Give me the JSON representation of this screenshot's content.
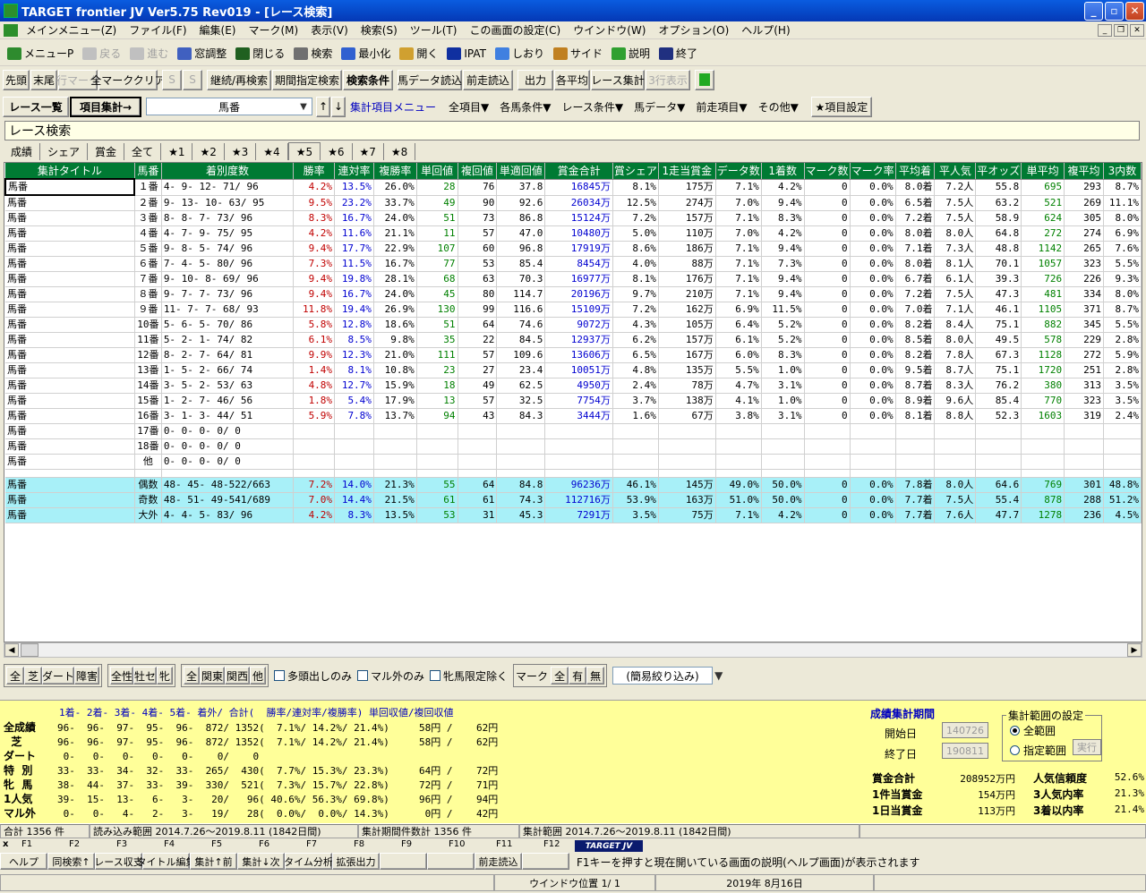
{
  "window": {
    "title": "TARGET frontier JV  Ver5.75  Rev019 - [レース検索]"
  },
  "menu": [
    "メインメニュー(Z)",
    "ファイル(F)",
    "編集(E)",
    "マーク(M)",
    "表示(V)",
    "検索(S)",
    "ツール(T)",
    "この画面の設定(C)",
    "ウインドウ(W)",
    "オプション(O)",
    "ヘルプ(H)"
  ],
  "toolbar1": [
    {
      "label": "メニューP",
      "icon": "menu-p-icon",
      "color": "#2e8b2e",
      "disabled": false
    },
    {
      "label": "戻る",
      "icon": "back-arrow-icon",
      "color": "#c0c0c0",
      "disabled": true
    },
    {
      "label": "進む",
      "icon": "forward-arrow-icon",
      "color": "#c0c0c0",
      "disabled": true
    },
    {
      "label": "窓調整",
      "icon": "window-adjust-icon",
      "color": "#4060c0",
      "disabled": false
    },
    {
      "label": "閉じる",
      "icon": "close-window-icon",
      "color": "#206020",
      "disabled": false
    },
    {
      "label": "検索",
      "icon": "search-icon",
      "color": "#707070",
      "disabled": false
    },
    {
      "label": "最小化",
      "icon": "minimize-icon",
      "color": "#3060d0",
      "disabled": false
    },
    {
      "label": "開く",
      "icon": "open-icon",
      "color": "#d0a030",
      "disabled": false
    },
    {
      "label": "IPAT",
      "icon": "pat-icon",
      "color": "#1030a0",
      "disabled": false
    },
    {
      "label": "しおり",
      "icon": "bookmark-icon",
      "color": "#4080e0",
      "disabled": false
    },
    {
      "label": "サイド",
      "icon": "side-icon",
      "color": "#c08020",
      "disabled": false
    },
    {
      "label": "説明",
      "icon": "help-icon",
      "color": "#30a030",
      "disabled": false
    },
    {
      "label": "終了",
      "icon": "exit-icon",
      "color": "#203080",
      "disabled": false
    }
  ],
  "toolbar2": [
    {
      "label": "先頭",
      "w": 30,
      "dis": false,
      "bold": false
    },
    {
      "label": "末尾",
      "w": 30,
      "dis": false,
      "bold": false
    },
    {
      "label": "行マーク",
      "w": 44,
      "dis": true,
      "bold": false
    },
    {
      "label": "全マーククリア",
      "w": 66,
      "dis": false,
      "bold": false
    },
    {
      "label": "S",
      "w": 22,
      "dis": true,
      "bold": false
    },
    {
      "label": "S",
      "w": 22,
      "dis": true,
      "bold": false
    },
    {
      "label": "継続/再検索",
      "w": 72,
      "dis": false,
      "bold": false
    },
    {
      "label": "期間指定検索",
      "w": 78,
      "dis": false,
      "bold": false
    },
    {
      "label": "検索条件",
      "w": 56,
      "dis": false,
      "bold": true
    },
    {
      "label": "馬データ読込",
      "w": 72,
      "dis": false,
      "bold": false
    },
    {
      "label": "前走読込",
      "w": 56,
      "dis": false,
      "bold": false
    },
    {
      "label": "出力",
      "w": 40,
      "dis": false,
      "bold": false
    },
    {
      "label": "各平均",
      "w": 40,
      "dis": false,
      "bold": false
    },
    {
      "label": "レース集計",
      "w": 60,
      "dis": false,
      "bold": false
    },
    {
      "label": "3行表示",
      "w": 50,
      "dis": true,
      "bold": false
    }
  ],
  "toolbar3": {
    "race_list": "レース一覧",
    "item_sum": "項目集計→",
    "combo_value": "馬番",
    "item_menu": "集計項目メニュー",
    "dropdowns": [
      "全項目▼",
      "各馬条件▼",
      "レース条件▼",
      "馬データ▼",
      "前走項目▼",
      "その他▼"
    ],
    "item_setting": "★項目設定"
  },
  "race_title": "レース検索",
  "tabs": [
    "成績",
    "シェア",
    "賞金",
    "全て",
    "★1",
    "★2",
    "★3",
    "★4",
    "★5",
    "★6",
    "★7",
    "★8"
  ],
  "active_tab": 8,
  "grid": {
    "headers": [
      "集計タイトル",
      "馬番",
      "着別度数",
      "勝率",
      "連対率",
      "複勝率",
      "単回値",
      "複回値",
      "単適回値",
      "賞金合計",
      "賞シェア",
      "1走当賞金",
      "データ数",
      "1着数",
      "マーク数",
      "マーク率",
      "平均着",
      "平人気",
      "平オッズ",
      "単平均",
      "複平均",
      "3内数"
    ],
    "rows": [
      [
        "馬番",
        "１番",
        "4-  9- 12- 71/ 96",
        "4.2%",
        "13.5%",
        "26.0%",
        "28",
        "76",
        "37.8",
        "16845万",
        "8.1%",
        "175万",
        "7.1%",
        "4.2%",
        "0",
        "0.0%",
        "8.0着",
        "7.2人",
        "55.8",
        "695",
        "293",
        "8.7%"
      ],
      [
        "馬番",
        "２番",
        "9- 13- 10- 63/ 95",
        "9.5%",
        "23.2%",
        "33.7%",
        "49",
        "90",
        "92.6",
        "26034万",
        "12.5%",
        "274万",
        "7.0%",
        "9.4%",
        "0",
        "0.0%",
        "6.5着",
        "7.5人",
        "63.2",
        "521",
        "269",
        "11.1%"
      ],
      [
        "馬番",
        "３番",
        "8-  8-  7- 73/ 96",
        "8.3%",
        "16.7%",
        "24.0%",
        "51",
        "73",
        "86.8",
        "15124万",
        "7.2%",
        "157万",
        "7.1%",
        "8.3%",
        "0",
        "0.0%",
        "7.2着",
        "7.5人",
        "58.9",
        "624",
        "305",
        "8.0%"
      ],
      [
        "馬番",
        "４番",
        "4-  7-  9- 75/ 95",
        "4.2%",
        "11.6%",
        "21.1%",
        "11",
        "57",
        "47.0",
        "10480万",
        "5.0%",
        "110万",
        "7.0%",
        "4.2%",
        "0",
        "0.0%",
        "8.0着",
        "8.0人",
        "64.8",
        "272",
        "274",
        "6.9%"
      ],
      [
        "馬番",
        "５番",
        "9-  8-  5- 74/ 96",
        "9.4%",
        "17.7%",
        "22.9%",
        "107",
        "60",
        "96.8",
        "17919万",
        "8.6%",
        "186万",
        "7.1%",
        "9.4%",
        "0",
        "0.0%",
        "7.1着",
        "7.3人",
        "48.8",
        "1142",
        "265",
        "7.6%"
      ],
      [
        "馬番",
        "６番",
        "7-  4-  5- 80/ 96",
        "7.3%",
        "11.5%",
        "16.7%",
        "77",
        "53",
        "85.4",
        "8454万",
        "4.0%",
        "88万",
        "7.1%",
        "7.3%",
        "0",
        "0.0%",
        "8.0着",
        "8.1人",
        "70.1",
        "1057",
        "323",
        "5.5%"
      ],
      [
        "馬番",
        "７番",
        "9- 10-  8- 69/ 96",
        "9.4%",
        "19.8%",
        "28.1%",
        "68",
        "63",
        "70.3",
        "16977万",
        "8.1%",
        "176万",
        "7.1%",
        "9.4%",
        "0",
        "0.0%",
        "6.7着",
        "6.1人",
        "39.3",
        "726",
        "226",
        "9.3%"
      ],
      [
        "馬番",
        "８番",
        "9-  7-  7- 73/ 96",
        "9.4%",
        "16.7%",
        "24.0%",
        "45",
        "80",
        "114.7",
        "20196万",
        "9.7%",
        "210万",
        "7.1%",
        "9.4%",
        "0",
        "0.0%",
        "7.2着",
        "7.5人",
        "47.3",
        "481",
        "334",
        "8.0%"
      ],
      [
        "馬番",
        "９番",
        "11-  7-  7- 68/ 93",
        "11.8%",
        "19.4%",
        "26.9%",
        "130",
        "99",
        "116.6",
        "15109万",
        "7.2%",
        "162万",
        "6.9%",
        "11.5%",
        "0",
        "0.0%",
        "7.0着",
        "7.1人",
        "46.1",
        "1105",
        "371",
        "8.7%"
      ],
      [
        "馬番",
        "10番",
        "5-  6-  5- 70/ 86",
        "5.8%",
        "12.8%",
        "18.6%",
        "51",
        "64",
        "74.6",
        "9072万",
        "4.3%",
        "105万",
        "6.4%",
        "5.2%",
        "0",
        "0.0%",
        "8.2着",
        "8.4人",
        "75.1",
        "882",
        "345",
        "5.5%"
      ],
      [
        "馬番",
        "11番",
        "5-  2-  1- 74/ 82",
        "6.1%",
        "8.5%",
        "9.8%",
        "35",
        "22",
        "84.5",
        "12937万",
        "6.2%",
        "157万",
        "6.1%",
        "5.2%",
        "0",
        "0.0%",
        "8.5着",
        "8.0人",
        "49.5",
        "578",
        "229",
        "2.8%"
      ],
      [
        "馬番",
        "12番",
        "8-  2-  7- 64/ 81",
        "9.9%",
        "12.3%",
        "21.0%",
        "111",
        "57",
        "109.6",
        "13606万",
        "6.5%",
        "167万",
        "6.0%",
        "8.3%",
        "0",
        "0.0%",
        "8.2着",
        "7.8人",
        "67.3",
        "1128",
        "272",
        "5.9%"
      ],
      [
        "馬番",
        "13番",
        "1-  5-  2- 66/ 74",
        "1.4%",
        "8.1%",
        "10.8%",
        "23",
        "27",
        "23.4",
        "10051万",
        "4.8%",
        "135万",
        "5.5%",
        "1.0%",
        "0",
        "0.0%",
        "9.5着",
        "8.7人",
        "75.1",
        "1720",
        "251",
        "2.8%"
      ],
      [
        "馬番",
        "14番",
        "3-  5-  2- 53/ 63",
        "4.8%",
        "12.7%",
        "15.9%",
        "18",
        "49",
        "62.5",
        "4950万",
        "2.4%",
        "78万",
        "4.7%",
        "3.1%",
        "0",
        "0.0%",
        "8.7着",
        "8.3人",
        "76.2",
        "380",
        "313",
        "3.5%"
      ],
      [
        "馬番",
        "15番",
        "1-  2-  7- 46/ 56",
        "1.8%",
        "5.4%",
        "17.9%",
        "13",
        "57",
        "32.5",
        "7754万",
        "3.7%",
        "138万",
        "4.1%",
        "1.0%",
        "0",
        "0.0%",
        "8.9着",
        "9.6人",
        "85.4",
        "770",
        "323",
        "3.5%"
      ],
      [
        "馬番",
        "16番",
        "3-  1-  3- 44/ 51",
        "5.9%",
        "7.8%",
        "13.7%",
        "94",
        "43",
        "84.3",
        "3444万",
        "1.6%",
        "67万",
        "3.8%",
        "3.1%",
        "0",
        "0.0%",
        "8.1着",
        "8.8人",
        "52.3",
        "1603",
        "319",
        "2.4%"
      ],
      [
        "馬番",
        "17番",
        "0-  0-  0-  0/  0",
        "",
        "",
        "",
        "",
        "",
        "",
        "",
        "",
        "",
        "",
        "",
        "",
        "",
        "",
        "",
        "",
        "",
        "",
        ""
      ],
      [
        "馬番",
        "18番",
        "0-  0-  0-  0/  0",
        "",
        "",
        "",
        "",
        "",
        "",
        "",
        "",
        "",
        "",
        "",
        "",
        "",
        "",
        "",
        "",
        "",
        "",
        ""
      ],
      [
        "馬番",
        "他",
        "0-  0-  0-  0/  0",
        "",
        "",
        "",
        "",
        "",
        "",
        "",
        "",
        "",
        "",
        "",
        "",
        "",
        "",
        "",
        "",
        "",
        "",
        ""
      ]
    ],
    "agg_rows": [
      [
        "馬番",
        "偶数",
        "48- 45- 48-522/663",
        "7.2%",
        "14.0%",
        "21.3%",
        "55",
        "64",
        "84.8",
        "96236万",
        "46.1%",
        "145万",
        "49.0%",
        "50.0%",
        "0",
        "0.0%",
        "7.8着",
        "8.0人",
        "64.6",
        "769",
        "301",
        "48.8%"
      ],
      [
        "馬番",
        "奇数",
        "48- 51- 49-541/689",
        "7.0%",
        "14.4%",
        "21.5%",
        "61",
        "61",
        "74.3",
        "112716万",
        "53.9%",
        "163万",
        "51.0%",
        "50.0%",
        "0",
        "0.0%",
        "7.7着",
        "7.5人",
        "55.4",
        "878",
        "288",
        "51.2%"
      ],
      [
        "馬番",
        "大外",
        "4-  4-  5- 83/ 96",
        "4.2%",
        "8.3%",
        "13.5%",
        "53",
        "31",
        "45.3",
        "7291万",
        "3.5%",
        "75万",
        "7.1%",
        "4.2%",
        "0",
        "0.0%",
        "7.7着",
        "7.6人",
        "47.7",
        "1278",
        "236",
        "4.5%"
      ]
    ]
  },
  "filters": {
    "g1": [
      "全",
      "芝",
      "ダート",
      "障害"
    ],
    "g2": [
      "全性",
      "牡セ",
      "牝"
    ],
    "g3": [
      "全",
      "関東",
      "関西",
      "他"
    ],
    "checks": [
      "多頭出しのみ",
      "マル外のみ",
      "牝馬限定除く"
    ],
    "mark_label": "マーク",
    "mark_btns": [
      "全",
      "有",
      "無"
    ],
    "narrow": "(簡易絞り込み)"
  },
  "stats": {
    "header": "1着- 2着- 3着- 4着- 5着- 着外/ 合計(  勝率/連対率/複勝率) 単回収値/複回収値",
    "rows": [
      {
        "label": "全成績",
        "text": "96-  96-  97-  95-  96-  872/ 1352(  7.1%/ 14.2%/ 21.4%)     58円 /    62円"
      },
      {
        "label": "  芝",
        "text": "96-  96-  97-  95-  96-  872/ 1352(  7.1%/ 14.2%/ 21.4%)     58円 /    62円"
      },
      {
        "label": "ダート",
        "text": " 0-   0-   0-   0-   0-    0/    0"
      },
      {
        "label": "特  別",
        "text": "33-  33-  34-  32-  33-  265/  430(  7.7%/ 15.3%/ 23.3%)     64円 /    72円"
      },
      {
        "label": "牝  馬",
        "text": "38-  44-  37-  33-  39-  330/  521(  7.3%/ 15.7%/ 22.8%)     72円 /    71円"
      },
      {
        "label": "1人気",
        "text": "39-  15-  13-   6-   3-   20/   96( 40.6%/ 56.3%/ 69.8%)     96円 /    94円"
      },
      {
        "label": "マル外",
        "text": " 0-   0-   4-   2-   3-   19/   28(  0.0%/  0.0%/ 14.3%)      0円 /    42円"
      }
    ]
  },
  "period": {
    "title": "成績集計期間",
    "start_label": "開始日",
    "start_value": "140726",
    "end_label": "終了日",
    "end_value": "190811",
    "range_legend": "集計範囲の設定",
    "opt_all": "全範囲",
    "opt_spec": "指定範囲",
    "run": "実行",
    "kv": [
      {
        "k": "賞金合計",
        "v": "208952万円",
        "k2": "人気信頼度",
        "v2": "52.6%"
      },
      {
        "k": "1件当賞金",
        "v": "154万円",
        "k2": "3人気内率",
        "v2": "21.3%"
      },
      {
        "k": "1日当賞金",
        "v": "113万円",
        "k2": "3着以内率",
        "v2": "21.4%"
      }
    ]
  },
  "status1": [
    "合計 1356 件",
    "読み込み範囲 2014.7.26～2019.8.11 (1842日間)",
    "集計期間件数計 1356 件",
    "集計範囲 2014.7.26～2019.8.11 (1842日間)"
  ],
  "fkeys": [
    "F1",
    "F2",
    "F3",
    "F4",
    "F5",
    "F6",
    "F7",
    "F8",
    "F9",
    "F10",
    "F11",
    "F12"
  ],
  "fbtns": [
    "ヘルプ",
    "同検索↑",
    "レース収支",
    "タイトル編集",
    "集計↑前",
    "集計↓次",
    "タイム分析",
    "拡張出力",
    "",
    "",
    "前走読込",
    ""
  ],
  "logo": "TARGET JV",
  "fhelp": "F1キーを押すと現在開いている画面の説明(ヘルプ画面)が表示されます",
  "status2": {
    "window_pos": "ウインドウ位置 1/ 1",
    "date": "2019年 8月16日"
  }
}
